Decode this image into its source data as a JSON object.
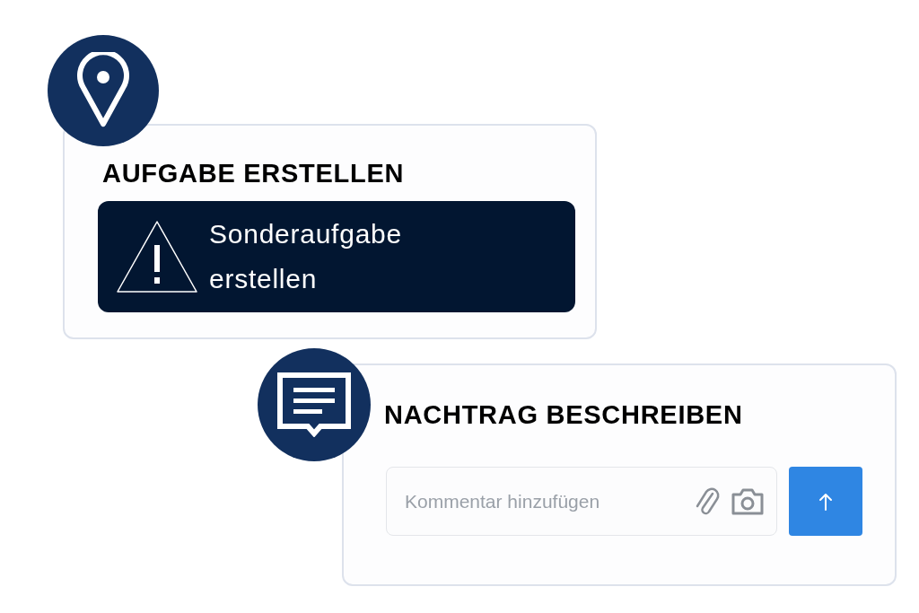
{
  "task_card": {
    "title": "AUFGABE ERSTELLEN",
    "button_label": "Sonderaufgabe erstellen"
  },
  "comment_card": {
    "title": "NACHTRAG BESCHREIBEN",
    "comment_field": {
      "placeholder": "Kommentar hinzufügen"
    }
  }
}
